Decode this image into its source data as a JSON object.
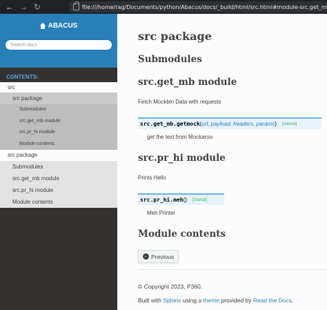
{
  "browser": {
    "back_icon": "arrow-left",
    "forward_icon": "arrow-right",
    "reload_icon": "reload",
    "url": "file:///home/rag/Documents/python/Abacus/docs/_build/html/src.html#module-src.get_mb"
  },
  "sidebar": {
    "project_name": "ABACUS",
    "search_placeholder": "Search docs",
    "contents_caption": "CONTENTS:",
    "nav": [
      {
        "label": "src",
        "level": 1
      },
      {
        "label": "src package",
        "level": 2
      },
      {
        "label": "Submodules",
        "level": 3
      },
      {
        "label": "src.get_mb module",
        "level": 3
      },
      {
        "label": "src.pr_hi module",
        "level": 3
      },
      {
        "label": "Module contents",
        "level": 3
      },
      {
        "label": "src package",
        "level": 1
      },
      {
        "label": "Submodules",
        "level": 2
      },
      {
        "label": "src.get_mb module",
        "level": 2
      },
      {
        "label": "src.pr_hi module",
        "level": 2
      },
      {
        "label": "Module contents",
        "level": 2
      }
    ]
  },
  "main": {
    "title": "src package",
    "submodules_heading": "Submodules",
    "get_mb": {
      "heading": "src.get_mb module",
      "description": "Fetch Mockbin Data with requests",
      "sig_module": "src.get_mb.",
      "sig_name": "getmock",
      "sig_open": "(",
      "sig_params": "url, payload, headers, params",
      "sig_close": ")",
      "source_label": "[source]",
      "doc": "get the text from Mockaroo"
    },
    "pr_hi": {
      "heading": "src.pr_hi module",
      "description": "Prints Hello",
      "sig_module": "src.pr_hi.",
      "sig_name": "meh",
      "sig_parens": "()",
      "source_label": "[source]",
      "doc": "Meh Printer"
    },
    "module_contents_heading": "Module contents",
    "previous_label": "Previous"
  },
  "footer": {
    "copyright": "© Copyright 2023, P360.",
    "built_with": "Built with ",
    "sphinx": "Sphinx",
    "using_a": " using a ",
    "theme": "theme",
    "provided_by": " provided by ",
    "rtd": "Read the Docs",
    "end": "."
  },
  "colors": {
    "sidebar_top": "#2980b9",
    "sidebar_bg": "#343131",
    "link": "#2980b9",
    "sig_bg": "#e7f2fa",
    "sig_border": "#6ab0de",
    "source_link": "#27ae60"
  }
}
